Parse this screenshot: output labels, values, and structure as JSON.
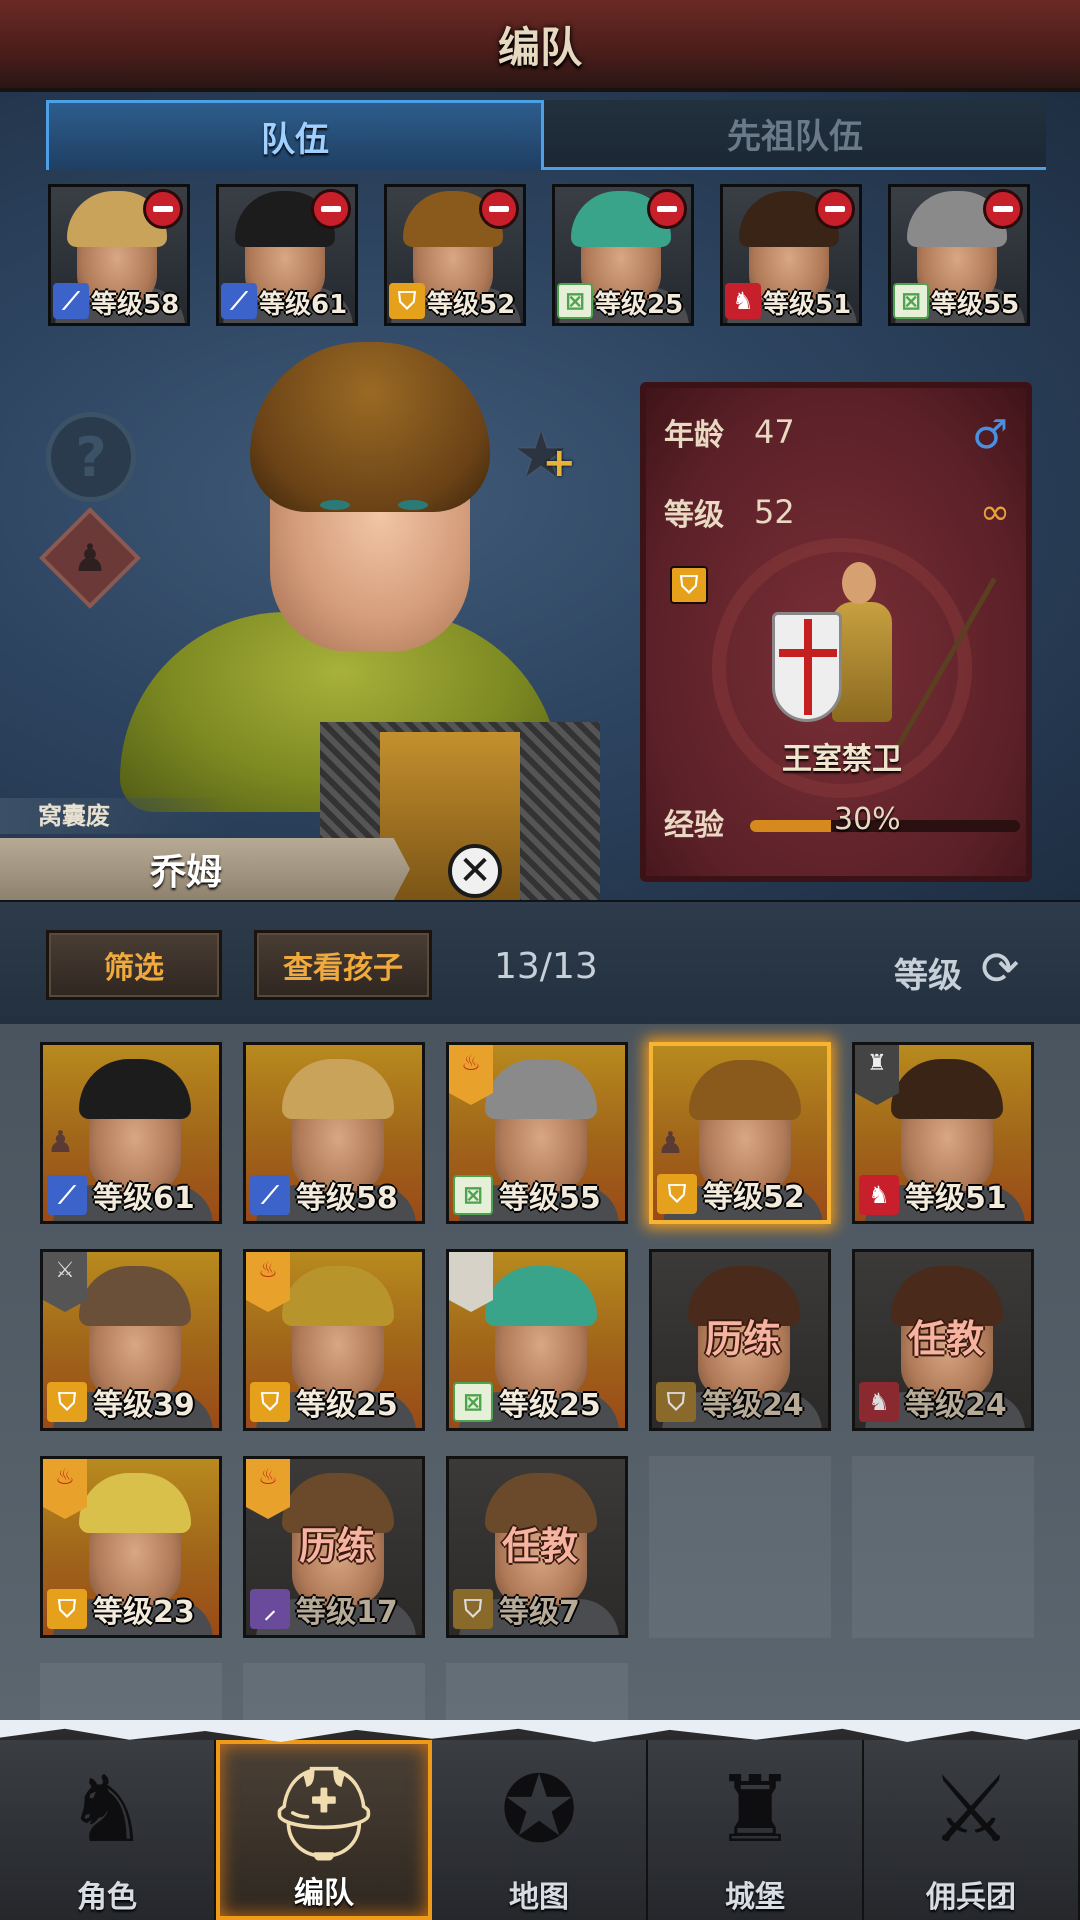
{
  "header": {
    "title": "编队"
  },
  "tabs": [
    {
      "label": "队伍",
      "active": true
    },
    {
      "label": "先祖队伍",
      "active": false
    }
  ],
  "team_members": [
    {
      "level_text": "等级58",
      "class_icon": "sword-icon",
      "hair": "#c9a35a",
      "remove_icon": "remove-icon"
    },
    {
      "level_text": "等级61",
      "class_icon": "sword-icon",
      "hair": "#1c1c1c",
      "remove_icon": "remove-icon"
    },
    {
      "level_text": "等级52",
      "class_icon": "shield-icon",
      "hair": "#8a5a1c",
      "remove_icon": "remove-icon"
    },
    {
      "level_text": "等级25",
      "class_icon": "bow-icon",
      "hair": "#3aa48a",
      "remove_icon": "remove-icon"
    },
    {
      "level_text": "等级51",
      "class_icon": "beast-icon",
      "hair": "#3a2416",
      "remove_icon": "remove-icon"
    },
    {
      "level_text": "等级55",
      "class_icon": "bow-icon",
      "hair": "#8a8a8a",
      "remove_icon": "remove-icon"
    }
  ],
  "selected_hero": {
    "trait": "窝囊废",
    "name": "乔姆",
    "age_label": "年龄",
    "age": "47",
    "level_label": "等级",
    "level": "52",
    "class_name": "王室禁卫",
    "exp_label": "经验",
    "exp_text": "30%",
    "exp_percent": 30,
    "gender_icon": "male-icon",
    "marriage_icon": "rings-icon"
  },
  "toolbar": {
    "filter_label": "筛选",
    "children_label": "查看孩子",
    "count": "13/13",
    "sort_label": "等级"
  },
  "roster": [
    {
      "level_text": "等级61",
      "class_icon": "sword-icon",
      "hair": "#1c1c1c",
      "flag": null,
      "status": "",
      "locked": false,
      "selected": false,
      "family": true
    },
    {
      "level_text": "等级58",
      "class_icon": "sword-icon",
      "hair": "#c9a35a",
      "flag": null,
      "status": "",
      "locked": false,
      "selected": false,
      "family": false
    },
    {
      "level_text": "等级55",
      "class_icon": "bow-icon",
      "hair": "#8a8a8a",
      "flag": "fire",
      "status": "",
      "locked": false,
      "selected": false,
      "family": false
    },
    {
      "level_text": "等级52",
      "class_icon": "shield-icon",
      "hair": "#8a5a1c",
      "flag": null,
      "status": "",
      "locked": false,
      "selected": true,
      "family": true
    },
    {
      "level_text": "等级51",
      "class_icon": "beast-icon",
      "hair": "#3a2416",
      "flag": "iron",
      "status": "",
      "locked": false,
      "selected": false,
      "family": false
    },
    {
      "level_text": "等级39",
      "class_icon": "shield-icon",
      "hair": "#6a5038",
      "flag": "grey",
      "status": "",
      "locked": false,
      "selected": false,
      "family": false
    },
    {
      "level_text": "等级25",
      "class_icon": "shield-icon",
      "hair": "#b8942c",
      "flag": "fire",
      "status": "",
      "locked": false,
      "selected": false,
      "family": false
    },
    {
      "level_text": "等级25",
      "class_icon": "bow-icon",
      "hair": "#3aa48a",
      "flag": "white",
      "status": "",
      "locked": false,
      "selected": false,
      "family": false
    },
    {
      "level_text": "等级24",
      "class_icon": "shield-icon",
      "hair": "#4a2a1a",
      "flag": null,
      "status": "历练",
      "locked": true,
      "selected": false,
      "family": false
    },
    {
      "level_text": "等级24",
      "class_icon": "beast-icon",
      "hair": "#4a2a1a",
      "flag": null,
      "status": "任教",
      "locked": true,
      "selected": false,
      "family": false
    },
    {
      "level_text": "等级23",
      "class_icon": "shield-icon",
      "hair": "#d8c04a",
      "flag": "fire",
      "status": "",
      "locked": false,
      "selected": false,
      "family": false
    },
    {
      "level_text": "等级17",
      "class_icon": "staff-icon",
      "hair": "#6a4a2a",
      "flag": "fire",
      "status": "历练",
      "locked": true,
      "selected": false,
      "family": false
    },
    {
      "level_text": "等级7",
      "class_icon": "shield-icon",
      "hair": "#6a4a2a",
      "flag": null,
      "status": "任教",
      "locked": true,
      "selected": false,
      "family": false
    }
  ],
  "nav": [
    {
      "label": "角色",
      "icon": "knight-icon",
      "active": false
    },
    {
      "label": "编队",
      "icon": "helmet-icon",
      "active": true
    },
    {
      "label": "地图",
      "icon": "compass-map-icon",
      "active": false
    },
    {
      "label": "城堡",
      "icon": "castle-icon",
      "active": false
    },
    {
      "label": "佣兵团",
      "icon": "mercenary-icon",
      "active": false
    }
  ]
}
